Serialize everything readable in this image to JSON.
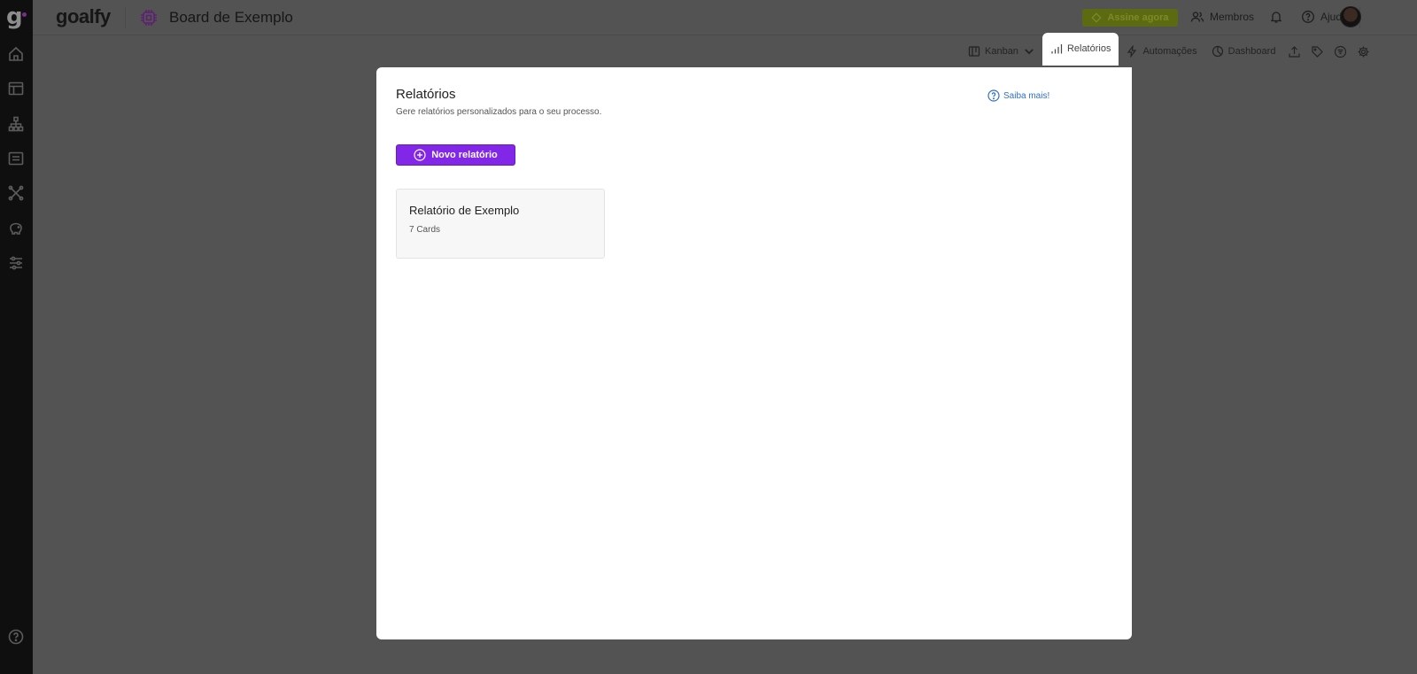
{
  "app": {
    "brand": "goalfy",
    "logo_mark": "g",
    "board_title": "Board de Exemplo",
    "accent": "#8226e8"
  },
  "topbar": {
    "subscribe_label": "Assine agora",
    "members_label": "Membros",
    "help_label": "Ajuda"
  },
  "toolbar": {
    "view_label": "Kanban",
    "reports_label": "Relatórios",
    "automations_label": "Automações",
    "dashboard_label": "Dashboard"
  },
  "modal": {
    "title": "Relatórios",
    "subtitle": "Gere relatórios personalizados para o seu processo.",
    "help_link": "Saiba mais!",
    "new_button": "Novo relatório",
    "reports": [
      {
        "title": "Relatório de Exemplo",
        "count": "7 Cards"
      }
    ]
  },
  "sidebar": {
    "icons": [
      "home-icon",
      "table-icon",
      "org-chart-icon",
      "list-icon",
      "integrations-icon",
      "piggy-bank-icon",
      "sliders-icon",
      "help-icon"
    ]
  }
}
